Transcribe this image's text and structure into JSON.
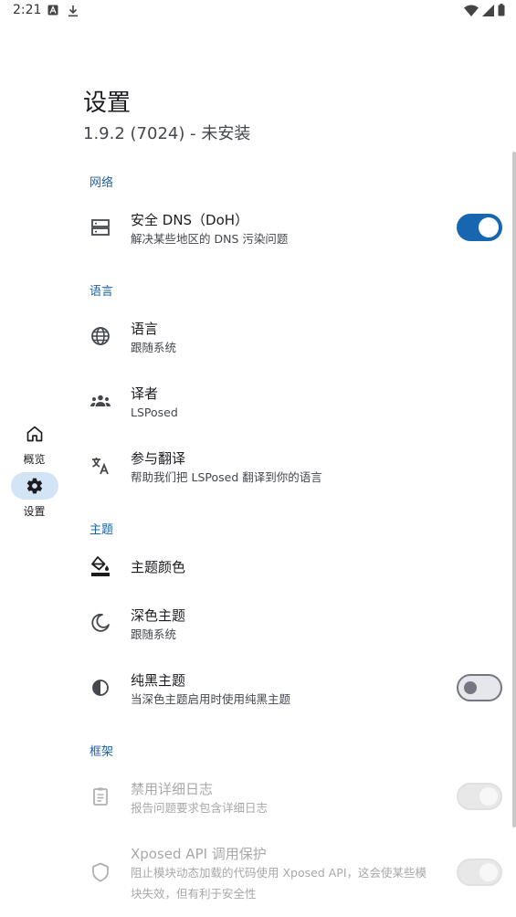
{
  "status_bar": {
    "time": "2:21"
  },
  "nav": {
    "items": [
      {
        "label": "概览"
      },
      {
        "label": "设置"
      }
    ]
  },
  "header": {
    "title": "设置",
    "subtitle": "1.9.2 (7024) - 未安装"
  },
  "sections": {
    "network": {
      "header": "网络"
    },
    "language": {
      "header": "语言"
    },
    "theme": {
      "header": "主题"
    },
    "framework": {
      "header": "框架"
    }
  },
  "prefs": {
    "doh": {
      "title": "安全 DNS（DoH）",
      "summary": "解决某些地区的 DNS 污染问题",
      "checked": true
    },
    "language": {
      "title": "语言",
      "summary": "跟随系统"
    },
    "translators": {
      "title": "译者",
      "summary": "LSPosed"
    },
    "translate": {
      "title": "参与翻译",
      "summary": "帮助我们把 LSPosed 翻译到你的语言"
    },
    "theme_color": {
      "title": "主题颜色"
    },
    "dark_theme": {
      "title": "深色主题",
      "summary": "跟随系统"
    },
    "black_theme": {
      "title": "纯黑主题",
      "summary": "当深色主题启用时使用纯黑主题",
      "checked": false
    },
    "verbose_log": {
      "title": "禁用详细日志",
      "summary": "报告问题要求包含详细日志",
      "enabled": false
    },
    "xposed_api": {
      "title": "Xposed API 调用保护",
      "summary_line1": "阻止模块动态加载的代码使用 Xposed API，这会使某些模",
      "summary_line2": "块失效，但有利于安全性",
      "enabled": false
    }
  },
  "colors": {
    "accent": "#1666b0",
    "nav_active": "#d3e4f6",
    "section": "#1b63a8"
  }
}
